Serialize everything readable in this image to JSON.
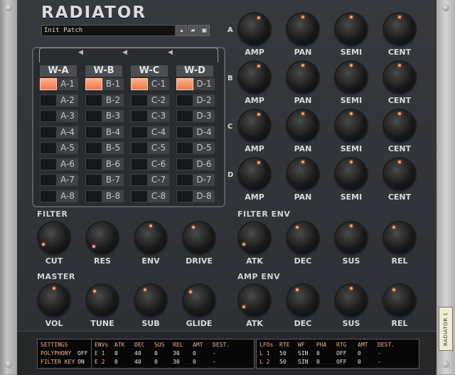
{
  "plugin": {
    "title": "RADIATOR",
    "rack_tag": "RADIATOR 1"
  },
  "patch": {
    "name": "Init Patch",
    "buttons": [
      "▲▼",
      "folder-icon",
      "save-icon"
    ]
  },
  "wave_table": {
    "columns": [
      {
        "header": "W-A",
        "rows": [
          "A-1",
          "A-2",
          "A-3",
          "A-4",
          "A-5",
          "A-6",
          "A-7",
          "A-8"
        ],
        "active_index": 0
      },
      {
        "header": "W-B",
        "rows": [
          "B-1",
          "B-2",
          "B-3",
          "B-4",
          "B-5",
          "B-6",
          "B-7",
          "B-8"
        ],
        "active_index": 0
      },
      {
        "header": "W-C",
        "rows": [
          "C-1",
          "C-2",
          "C-3",
          "C-4",
          "C-5",
          "C-6",
          "C-7",
          "C-8"
        ],
        "active_index": 0
      },
      {
        "header": "W-D",
        "rows": [
          "D-1",
          "D-2",
          "D-3",
          "D-4",
          "D-5",
          "D-6",
          "D-7",
          "D-8"
        ],
        "active_index": 0
      }
    ]
  },
  "osc_rows": [
    {
      "label": "A",
      "knobs": [
        "AMP",
        "PAN",
        "SEMI",
        "CENT"
      ]
    },
    {
      "label": "B",
      "knobs": [
        "AMP",
        "PAN",
        "SEMI",
        "CENT"
      ]
    },
    {
      "label": "C",
      "knobs": [
        "AMP",
        "PAN",
        "SEMI",
        "CENT"
      ]
    },
    {
      "label": "D",
      "knobs": [
        "AMP",
        "PAN",
        "SEMI",
        "CENT"
      ]
    }
  ],
  "filter": {
    "title": "FILTER",
    "knobs": [
      "CUT",
      "RES",
      "ENV",
      "DRIVE"
    ]
  },
  "filter_env": {
    "title": "FILTER ENV",
    "knobs": [
      "ATK",
      "DEC",
      "SUS",
      "REL"
    ]
  },
  "master": {
    "title": "MASTER",
    "knobs": [
      "VOL",
      "TUNE",
      "SUB",
      "GLIDE"
    ]
  },
  "amp_env": {
    "title": "AMP ENV",
    "knobs": [
      "ATK",
      "DEC",
      "SUS",
      "REL"
    ]
  },
  "settings": {
    "header": "SETTINGS",
    "rows": [
      {
        "label": "POLYPHONY",
        "value": "OFF"
      },
      {
        "label": "FILTER KEY",
        "value": "ON"
      }
    ]
  },
  "env_table": {
    "headers": [
      "ENVs",
      "ATK",
      "DEC",
      "SUS",
      "REL",
      "AMT",
      "DEST."
    ],
    "rows": [
      [
        "E 1",
        "0",
        "40",
        "0",
        "30",
        "0",
        "-"
      ],
      [
        "E 2",
        "0",
        "40",
        "0",
        "30",
        "0",
        "-"
      ]
    ]
  },
  "lfo_table": {
    "headers": [
      "LFOs",
      "RTE",
      "WF",
      "PHA",
      "RTG",
      "AMT",
      "DEST."
    ],
    "rows": [
      [
        "L 1",
        "50",
        "SIN",
        "0",
        "OFF",
        "0",
        "-"
      ],
      [
        "L 2",
        "50",
        "SIN",
        "0",
        "OFF",
        "0",
        "-"
      ]
    ]
  }
}
